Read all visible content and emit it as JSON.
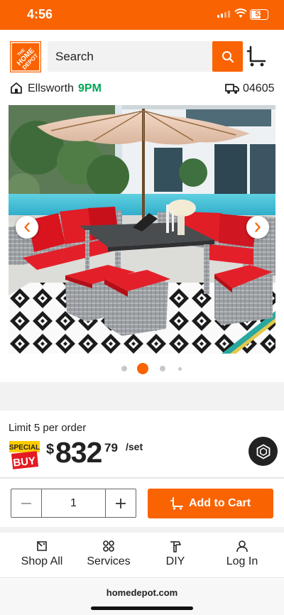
{
  "status_bar": {
    "time": "4:56",
    "battery": "53"
  },
  "header": {
    "search_placeholder": "Search",
    "search_icon": "search-icon",
    "cart_icon": "cart-icon"
  },
  "store": {
    "name": "Ellsworth",
    "hours": "9PM",
    "zip": "04605"
  },
  "carousel": {
    "active_index": 1,
    "dot_count": 4
  },
  "product": {
    "limit_text": "Limit 5 per order",
    "badge_line1": "SPECIAL",
    "badge_line2": "BUY",
    "price_symbol": "$",
    "price_whole": "832",
    "price_cents": "79",
    "price_unit": "/set"
  },
  "purchase": {
    "quantity": "1",
    "add_to_cart_label": "Add to Cart"
  },
  "bottom_nav": {
    "items": [
      {
        "label": "Shop All",
        "icon": "shop-all-icon"
      },
      {
        "label": "Services",
        "icon": "services-icon"
      },
      {
        "label": "DIY",
        "icon": "diy-icon"
      },
      {
        "label": "Log In",
        "icon": "user-icon"
      }
    ]
  },
  "browser": {
    "url": "homedepot.com"
  },
  "colors": {
    "brand": "#f96302",
    "store_hours": "#00a652"
  }
}
